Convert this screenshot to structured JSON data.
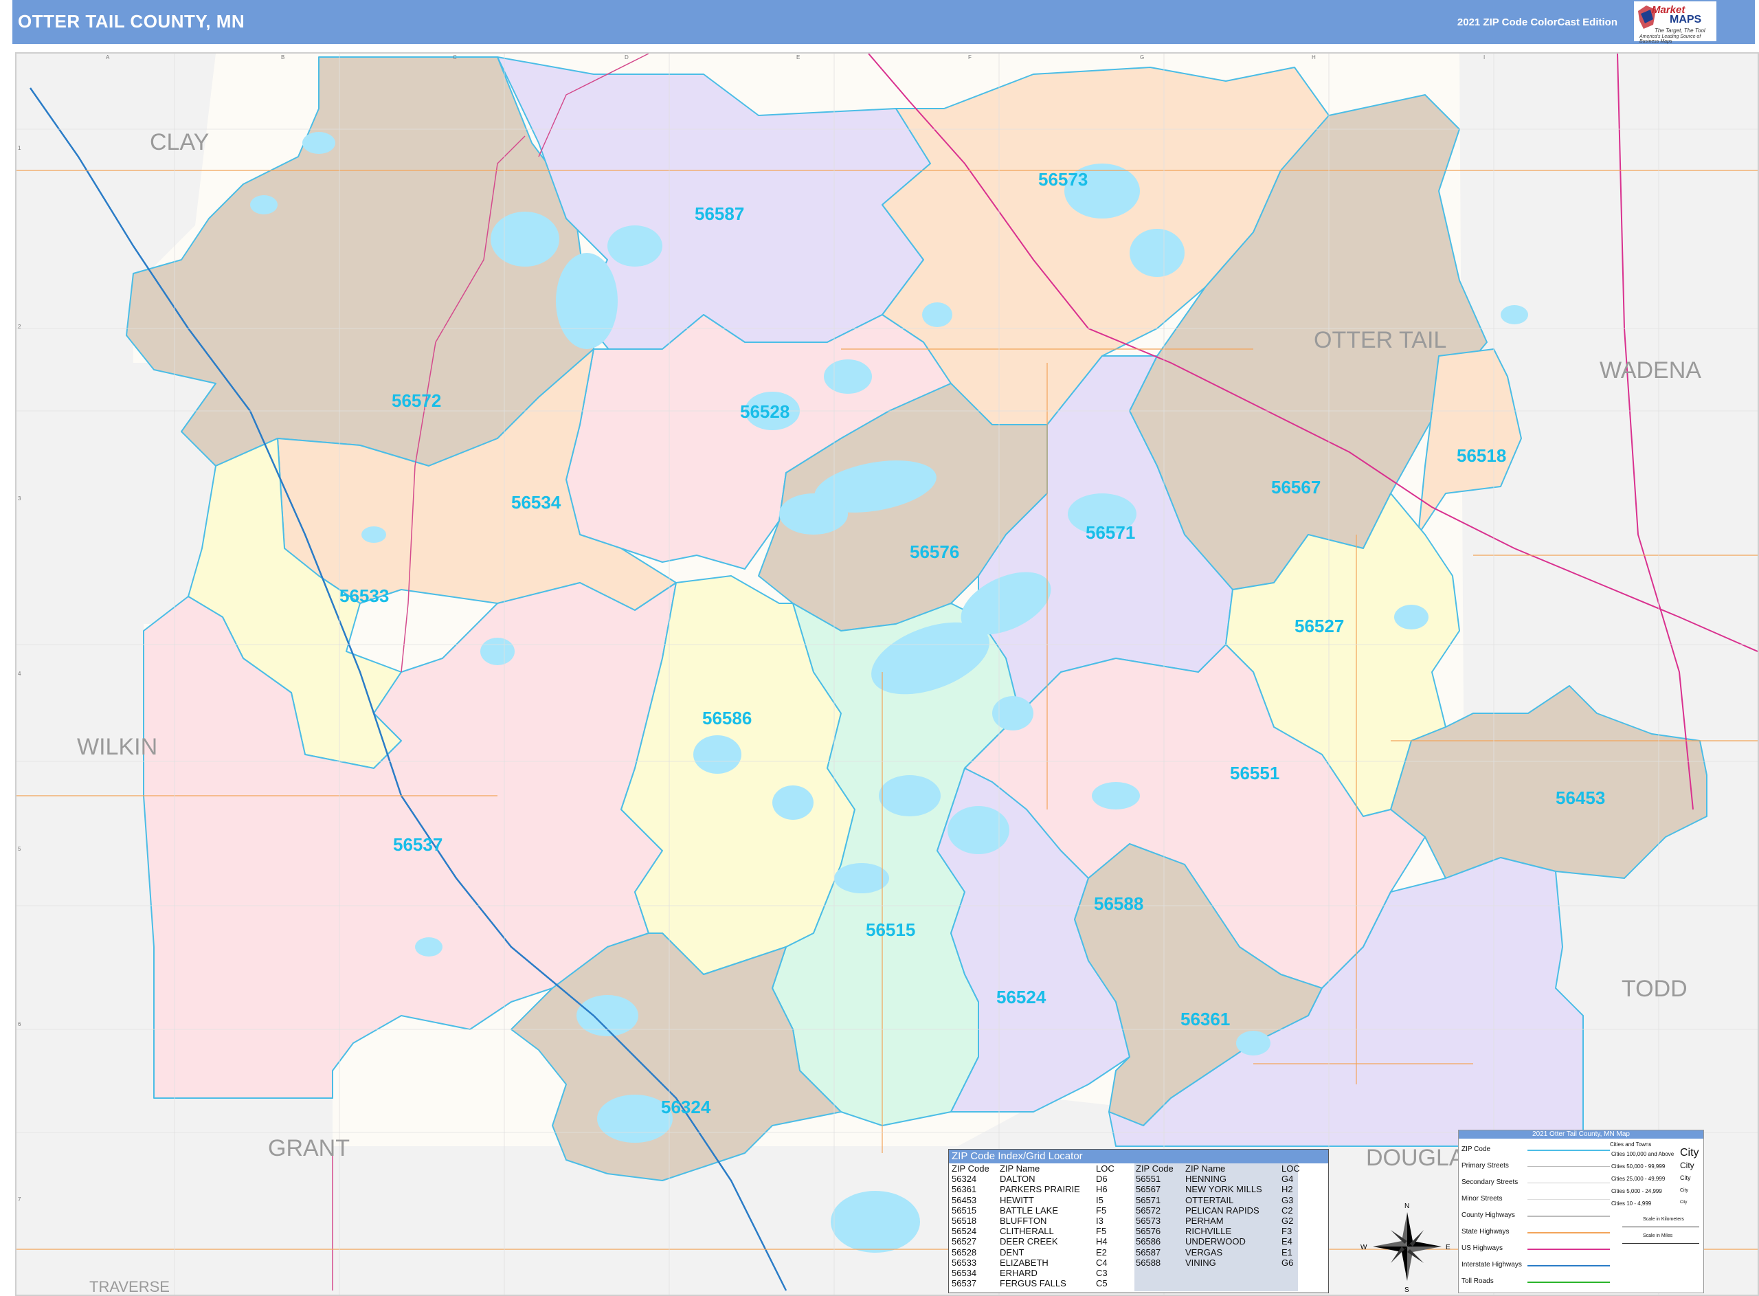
{
  "header": {
    "title": "OTTER TAIL COUNTY, MN",
    "edition": "2021 ZIP Code ColorCast Edition",
    "logo_brand_top": "Market",
    "logo_brand_bottom": "MAPS",
    "logo_tagline": "The Target, The Tool",
    "logo_tagline2": "America's Leading Source of Business Maps"
  },
  "counties": {
    "clay": "CLAY",
    "wilkin": "WILKIN",
    "grant": "GRANT",
    "traverse": "TRAVERSE",
    "otter_tail": "OTTER TAIL",
    "wadena": "WADENA",
    "todd": "TODD",
    "douglas": "DOUGLA"
  },
  "zip_labels": {
    "z56587": "56587",
    "z56573": "56573",
    "z56572": "56572",
    "z56528": "56528",
    "z56534": "56534",
    "z56567": "56567",
    "z56518": "56518",
    "z56576": "56576",
    "z56571": "56571",
    "z56533": "56533",
    "z56527": "56527",
    "z56586": "56586",
    "z56551": "56551",
    "z56453": "56453",
    "z56537": "56537",
    "z56588": "56588",
    "z56515": "56515",
    "z56524": "56524",
    "z56361": "56361",
    "z56324": "56324"
  },
  "zip_colors": {
    "tan": "#dccfc0",
    "peach": "#fde3cc",
    "lavender": "#e5def8",
    "pink": "#fde2e6",
    "yellow": "#fdfbd4",
    "mint": "#d9f8e8",
    "water": "#a9e6fb",
    "border": "#4bbde6",
    "text": "#18bde8"
  },
  "grid": {
    "columns": [
      "A",
      "B",
      "C",
      "D",
      "E",
      "F",
      "G",
      "H",
      "I"
    ],
    "rows": [
      "1",
      "2",
      "3",
      "4",
      "5",
      "6",
      "7"
    ]
  },
  "index": {
    "title": "ZIP Code Index/Grid Locator",
    "headers": {
      "zip": "ZIP Code",
      "name": "ZIP Name",
      "loc": "LOC"
    },
    "left": {
      "zip": [
        "ZIP Code",
        "56324",
        "56361",
        "56453",
        "56515",
        "56518",
        "56524",
        "56527",
        "56528",
        "56533",
        "56534",
        "56537"
      ],
      "name": [
        "ZIP Name",
        "DALTON",
        "PARKERS PRAIRIE",
        "HEWITT",
        "BATTLE LAKE",
        "BLUFFTON",
        "CLITHERALL",
        "DEER CREEK",
        "DENT",
        "ELIZABETH",
        "ERHARD",
        "FERGUS FALLS"
      ],
      "loc": [
        "LOC",
        "D6",
        "H6",
        "I5",
        "F5",
        "I3",
        "F5",
        "H4",
        "E2",
        "C4",
        "C3",
        "C5"
      ]
    },
    "right": {
      "zip": [
        "ZIP Code",
        "56551",
        "56567",
        "56571",
        "56572",
        "56573",
        "56576",
        "56586",
        "56587",
        "56588"
      ],
      "name": [
        "ZIP Name",
        "HENNING",
        "NEW YORK MILLS",
        "OTTERTAIL",
        "PELICAN RAPIDS",
        "PERHAM",
        "RICHVILLE",
        "UNDERWOOD",
        "VERGAS",
        "VINING"
      ],
      "loc": [
        "LOC",
        "G4",
        "H2",
        "G3",
        "C2",
        "G2",
        "F3",
        "E4",
        "E1",
        "G6"
      ]
    }
  },
  "legend": {
    "title": "2021 Otter Tail County, MN Map",
    "cities_header": "Cities and Towns",
    "items": [
      "ZIP Code",
      "Primary Streets",
      "Secondary Streets",
      "Minor Streets",
      "County Highways",
      "State Highways",
      "US Highways",
      "Interstate Highways",
      "Toll Roads"
    ],
    "cities": [
      {
        "range": "Cities 100,000 and Above",
        "sample": "City"
      },
      {
        "range": "Cities 50,000 - 99,999",
        "sample": "City"
      },
      {
        "range": "Cities 25,000 - 49,999",
        "sample": "City"
      },
      {
        "range": "Cities 5,000 - 24,999",
        "sample": "City"
      },
      {
        "range": "Cities 10 - 4,999",
        "sample": "City"
      }
    ],
    "scale_km": "Scale in Kilometers",
    "scale_mi": "Scale in Miles"
  },
  "compass": {
    "n": "N",
    "s": "S",
    "e": "E",
    "w": "W"
  }
}
